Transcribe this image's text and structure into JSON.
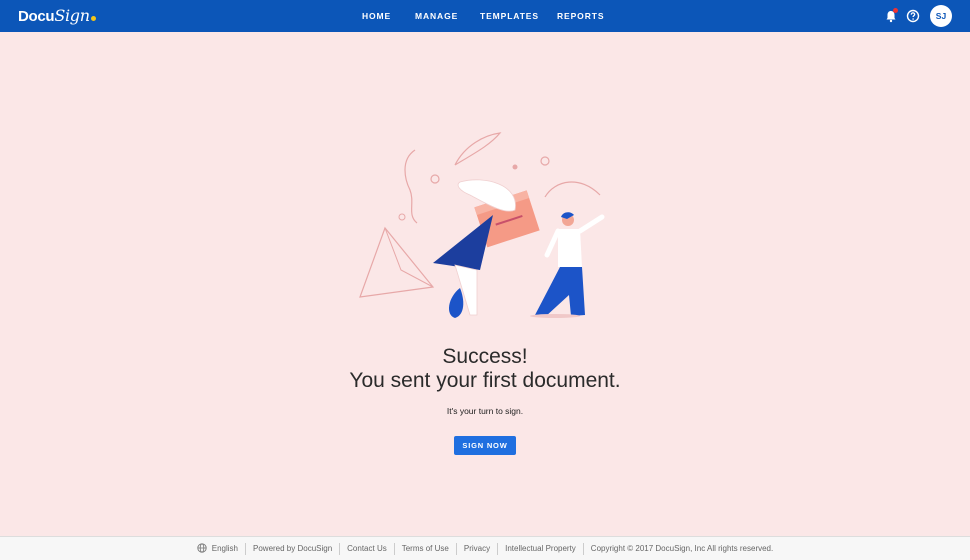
{
  "header": {
    "logo_text_a": "Docu",
    "logo_text_b": "Sign",
    "nav": [
      "HOME",
      "MANAGE",
      "TEMPLATES",
      "REPORTS"
    ],
    "avatar_initials": "SJ"
  },
  "main": {
    "headline_1": "Success!",
    "headline_2": "You sent your first document.",
    "subtext": "It's your turn to sign.",
    "sign_button": "SIGN NOW"
  },
  "footer": {
    "language": "English",
    "powered": "Powered by DocuSign",
    "contact": "Contact Us",
    "terms": "Terms of Use",
    "privacy": "Privacy",
    "ip": "Intellectual Property",
    "copyright": "Copyright © 2017 DocuSign, Inc All rights reserved."
  },
  "colors": {
    "header_bg": "#0c56b8",
    "page_bg": "#fbe7e7",
    "button_bg": "#1f6fe0"
  },
  "icons": [
    "globe-icon",
    "bell-icon",
    "help-icon"
  ]
}
